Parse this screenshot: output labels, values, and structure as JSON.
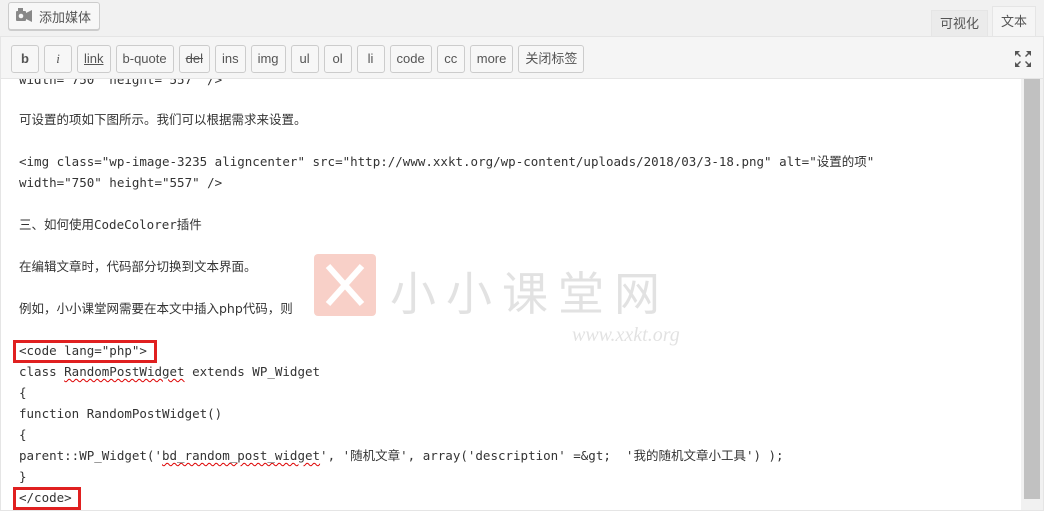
{
  "toolbar_top": {
    "add_media_label": "添加媒体",
    "tabs": [
      {
        "label": "可视化",
        "active": false
      },
      {
        "label": "文本",
        "active": true
      }
    ]
  },
  "quicktags": [
    "b",
    "i",
    "link",
    "b-quote",
    "del",
    "ins",
    "img",
    "ul",
    "ol",
    "li",
    "code",
    "cc",
    "more",
    "关闭标签"
  ],
  "editor": {
    "lines": [
      "可设置的项如下图所示。我们可以根据需求来设置。",
      "<img class=\"wp-image-3235 aligncenter\" src=\"http://www.xxkt.org/wp-content/uploads/2018/03/3-18.png\" alt=\"设置的项\"",
      "width=\"750\" height=\"557\" />",
      "三、如何使用CodeColorer插件",
      "在编辑文章时，代码部分切换到文本界面。",
      "例如，小小课堂网需要在本文中插入php代码，则",
      "<code lang=\"php\">",
      "class RandomPostWidget extends WP_Widget",
      "{",
      "function RandomPostWidget()",
      "{",
      "parent::WP_Widget('bd_random_post_widget', '随机文章', array('description' =&gt;  '我的随机文章小工具') );",
      "}",
      "</code>"
    ],
    "partial_top_line": "width=\"750\" height=\"557\" />"
  },
  "watermark": {
    "title": "小小课堂网",
    "url": "www.xxkt.org"
  },
  "colors": {
    "highlight_border": "#e02020",
    "watermark_logo": "#e85a3c"
  }
}
